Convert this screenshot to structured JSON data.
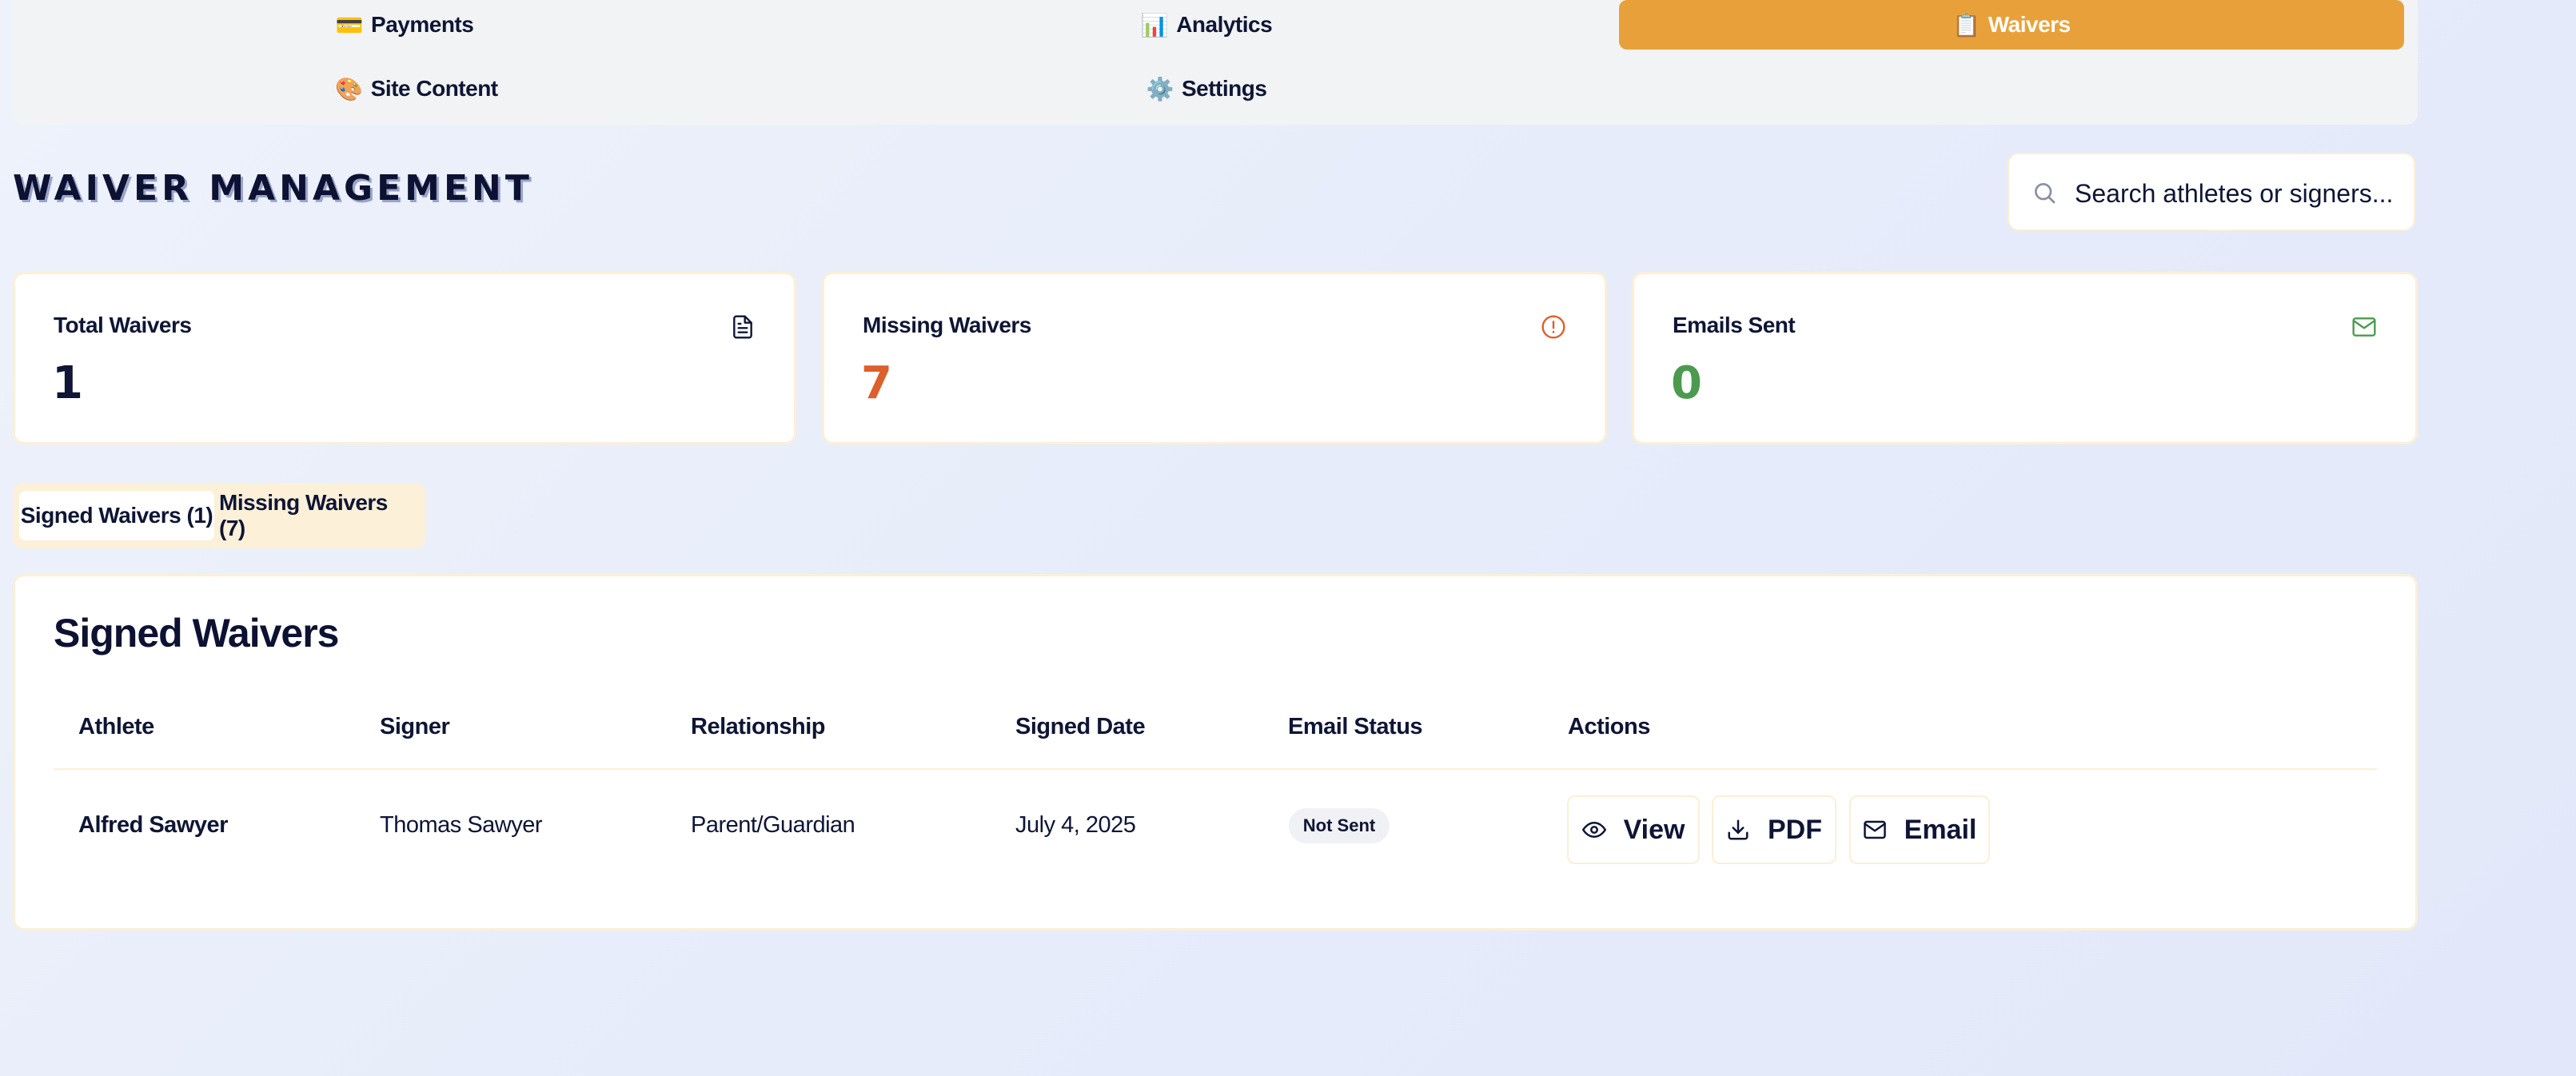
{
  "nav": {
    "items": [
      {
        "label": "Payments",
        "emoji": "💳",
        "active": false
      },
      {
        "label": "Analytics",
        "emoji": "📊",
        "active": false
      },
      {
        "label": "Waivers",
        "emoji": "📋",
        "active": true
      },
      {
        "label": "Site Content",
        "emoji": "🎨",
        "active": false
      },
      {
        "label": "Settings",
        "emoji": "⚙️",
        "active": false
      }
    ]
  },
  "header": {
    "title": "WAIVER MANAGEMENT",
    "search_placeholder": "Search athletes or signers..."
  },
  "stats": [
    {
      "label": "Total Waivers",
      "value": "1",
      "icon": "document-icon",
      "color": "#0f1535"
    },
    {
      "label": "Missing Waivers",
      "value": "7",
      "icon": "alert-circle-icon",
      "color": "#dd5f2b"
    },
    {
      "label": "Emails Sent",
      "value": "0",
      "icon": "mail-icon",
      "color": "#4c9a4f"
    }
  ],
  "tabs": [
    {
      "label": "Signed Waivers (1)",
      "active": true
    },
    {
      "label": "Missing Waivers (7)",
      "active": false
    }
  ],
  "table": {
    "title": "Signed Waivers",
    "columns": [
      "Athlete",
      "Signer",
      "Relationship",
      "Signed Date",
      "Email Status",
      "Actions"
    ],
    "rows": [
      {
        "athlete": "Alfred Sawyer",
        "signer": "Thomas Sawyer",
        "relationship": "Parent/Guardian",
        "signed_date": "July 4, 2025",
        "email_status": "Not Sent",
        "actions": {
          "view": "View",
          "pdf": "PDF",
          "email": "Email"
        }
      }
    ]
  },
  "colors": {
    "accent": "#e8a13a",
    "border": "#fbefd6",
    "missing": "#dd5f2b",
    "sent": "#4c9a4f"
  }
}
